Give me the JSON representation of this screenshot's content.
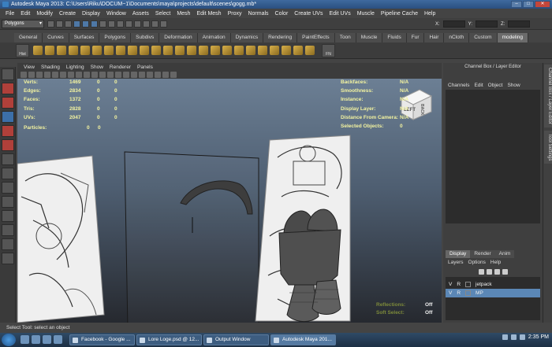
{
  "window": {
    "title": "Autodesk Maya 2013: C:\\Users\\Riku\\DOCUM~1\\Documents\\maya\\projects\\default\\scenes\\gogg.mb*"
  },
  "menubar": [
    "File",
    "Edit",
    "Modify",
    "Create",
    "Display",
    "Window",
    "Assets",
    "Select",
    "Mesh",
    "Edit Mesh",
    "Proxy",
    "Normals",
    "Color",
    "Create UVs",
    "Edit UVs",
    "Muscle",
    "Pipeline Cache",
    "Help"
  ],
  "mode_select": "Polygons",
  "xyz_labels": [
    "X:",
    "Y:",
    "Z:"
  ],
  "shelf_tabs": [
    "General",
    "Curves",
    "Surfaces",
    "Polygons",
    "Subdivs",
    "Deformation",
    "Animation",
    "Dynamics",
    "Rendering",
    "PaintEffects",
    "Toon",
    "Muscle",
    "Fluids",
    "Fur",
    "Hair",
    "nCloth",
    "Custom",
    "modeling"
  ],
  "shelf_active": "modeling",
  "shelf_buttons": {
    "hist": "Hist",
    "fn": "FN"
  },
  "panel_menu": [
    "View",
    "Shading",
    "Lighting",
    "Show",
    "Renderer",
    "Panels"
  ],
  "hud_left": [
    {
      "label": "Verts:",
      "v1": "1469",
      "v2": "0",
      "v3": "0"
    },
    {
      "label": "Edges:",
      "v1": "2834",
      "v2": "0",
      "v3": "0"
    },
    {
      "label": "Faces:",
      "v1": "1372",
      "v2": "0",
      "v3": "0"
    },
    {
      "label": "Tris:",
      "v1": "2828",
      "v2": "0",
      "v3": "0"
    },
    {
      "label": "UVs:",
      "v1": "2047",
      "v2": "0",
      "v3": "0"
    }
  ],
  "hud_particles": {
    "label": "Particles:",
    "v1": "0",
    "v2": "0"
  },
  "hud_right": [
    {
      "label": "Backfaces:",
      "value": "N/A"
    },
    {
      "label": "Smoothness:",
      "value": "N/A"
    },
    {
      "label": "Instance:",
      "value": "N/A"
    },
    {
      "label": "Display Layer:",
      "value": "N/A"
    },
    {
      "label": "Distance From Camera:",
      "value": "N/A"
    },
    {
      "label": "Selected Objects:",
      "value": "0"
    }
  ],
  "hud_bottom": [
    {
      "label": "Reflections:",
      "value": "Off"
    },
    {
      "label": "Soft Select:",
      "value": "Off"
    }
  ],
  "viewcube": {
    "left": "LEFT",
    "back": "BACK"
  },
  "channel_box": {
    "header": "Channel Box / Layer Editor",
    "menu": [
      "Channels",
      "Edit",
      "Object",
      "Show"
    ]
  },
  "layer_editor": {
    "tabs": [
      "Display",
      "Render",
      "Anim"
    ],
    "active_tab": "Display",
    "menu": [
      "Layers",
      "Options",
      "Help"
    ],
    "layers": [
      {
        "v": "V",
        "r": "R",
        "name": "jetpack",
        "selected": false
      },
      {
        "v": "V",
        "r": "R",
        "name": "MP",
        "selected": true
      }
    ]
  },
  "side_tabs": [
    "Channel Box / Layer Editor",
    "Tool Settings"
  ],
  "help_line": "Select Tool: select an object",
  "taskbar": {
    "tasks": [
      "Facebook - Google ...",
      "Lore Loge.psd @ 12...",
      "Output Window",
      "Autodesk Maya 201..."
    ],
    "active_task": "Autodesk Maya 201...",
    "clock": "2:35 PM"
  }
}
